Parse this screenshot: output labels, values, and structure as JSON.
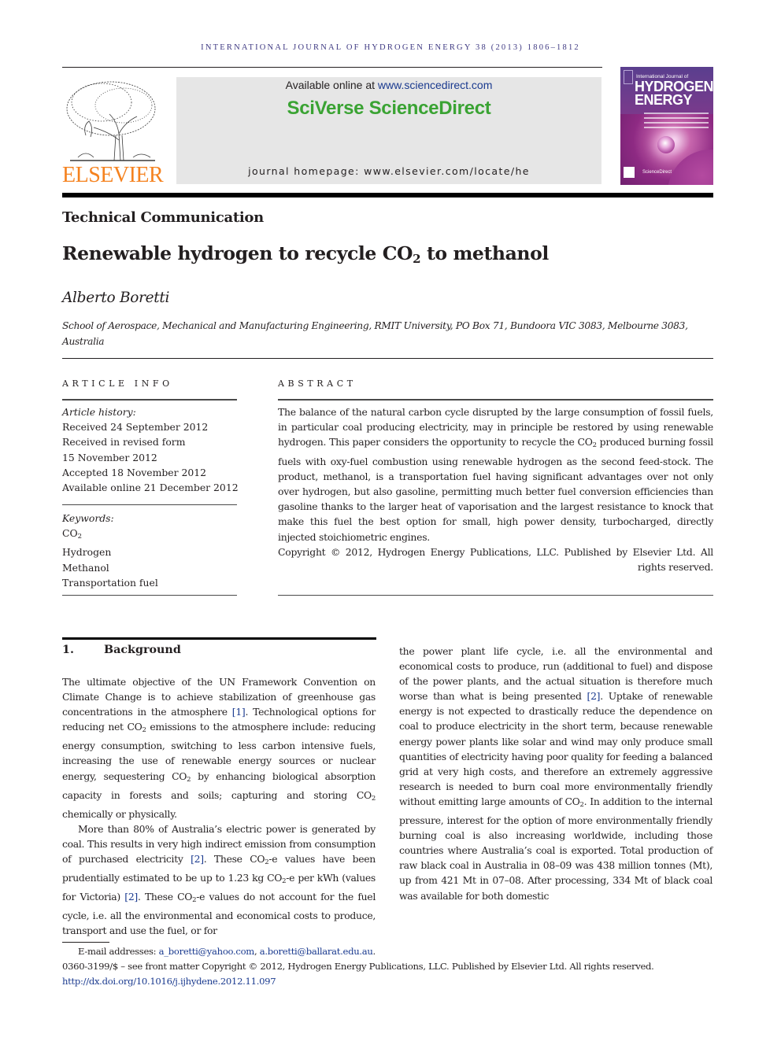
{
  "running_head": "International Journal of Hydrogen Energy 38 (2013) 1806–1812",
  "publisher": {
    "logo_word": "ELSEVIER",
    "logo_color": "#f5821f"
  },
  "banner": {
    "available_prefix": "Available online at ",
    "available_link": "www.sciencedirect.com",
    "brand": "SciVerse ScienceDirect",
    "brand_color": "#3aa333",
    "homepage": "journal homepage: www.elsevier.com/locate/he"
  },
  "cover": {
    "title_small": "International Journal of",
    "title_line1": "HYDROGEN",
    "title_line2": "ENERGY",
    "footer": "ScienceDirect"
  },
  "article": {
    "type": "Technical Communication",
    "title_pre": "Renewable hydrogen to recycle CO",
    "title_sub": "2",
    "title_post": " to methanol",
    "author": "Alberto Boretti",
    "affiliation": "School of Aerospace, Mechanical and Manufacturing Engineering, RMIT University, PO Box 71, Bundoora VIC 3083, Melbourne 3083, Australia"
  },
  "article_info": {
    "label": "ARTICLE INFO",
    "history_label": "Article history:",
    "history": [
      "Received 24 September 2012",
      "Received in revised form",
      "15 November 2012",
      "Accepted 18 November 2012",
      "Available online 21 December 2012"
    ],
    "keywords_label": "Keywords:",
    "keywords": [
      "CO",
      "Hydrogen",
      "Methanol",
      "Transportation fuel"
    ],
    "keyword_sub": "2"
  },
  "abstract": {
    "label": "ABSTRACT",
    "text_1": "The balance of the natural carbon cycle disrupted by the large consumption of fossil fuels, in particular coal producing electricity, may in principle be restored by using renewable hydrogen. This paper considers the opportunity to recycle the CO",
    "sub": "2",
    "text_2": " produced burning fossil fuels with oxy-fuel combustion using renewable hydrogen as the second feed-stock. The product, methanol, is a transportation fuel having significant advantages over not only over hydrogen, but also gasoline, permitting much better fuel conversion efficiencies than gasoline thanks to the larger heat of vaporisation and the largest resistance to knock that make this fuel the best option for small, high power density, turbocharged, directly injected stoichiometric engines.",
    "copyright": "Copyright © 2012, Hydrogen Energy Publications, LLC. Published by Elsevier Ltd. All rights reserved."
  },
  "section1": {
    "number": "1.",
    "title": "Background",
    "p1": [
      "The ultimate objective of the UN Framework Convention on Climate Change is to achieve stabilization of greenhouse gas concentrations in the atmosphere ",
      "[1]",
      ". Technological options for reducing net CO",
      " emissions to the atmosphere include: reducing energy consumption, switching to less carbon intensive fuels, increasing the use of renewable energy sources or nuclear energy, sequestering CO",
      " by enhancing biological absorption capacity in forests and soils; capturing and storing CO",
      " chemically or physically."
    ],
    "p2": [
      "More than 80% of Australia’s electric power is generated by coal. This results in very high indirect emission from consumption of purchased electricity ",
      "[2]",
      ". These CO",
      "-e values have been prudentially estimated to be up to 1.23 kg CO",
      "-e per kWh (values for Victoria) ",
      "[2]",
      ". These CO",
      "-e values do not account for the fuel cycle, i.e. all the environmental and economical costs to produce, transport and use the fuel, or for the power plant life cycle, i.e. all the environmental and economical costs to produce, run (additional to fuel) and dispose of the power plants, and the actual situation is therefore much worse than what is being presented ",
      "[2]",
      ". Uptake of renewable energy is not expected to drastically reduce the dependence on coal to produce electricity in the short term, because renewable energy power plants like solar and wind may only produce small quantities of electricity having poor quality for feeding a balanced grid at very high costs, and therefore an extremely aggressive research is needed to burn coal more environmentally friendly without emitting large amounts of CO",
      ". In addition to the internal pressure, interest for the option of more environmentally friendly burning coal is also increasing worldwide, including those countries where Australia’s coal is exported. Total production of raw black coal in Australia in 08–09 was 438 million tonnes (Mt), up from 421 Mt in 07–08. After processing, 334 Mt of black coal was available for both domestic"
    ],
    "sub": "2"
  },
  "footnotes": {
    "email_label": "E-mail addresses: ",
    "email_1": "a_boretti@yahoo.com",
    "email_sep": ", ",
    "email_2": "a.boretti@ballarat.edu.au",
    "email_end": ".",
    "issn_line": "0360-3199/$ – see front matter Copyright © 2012, Hydrogen Energy Publications, LLC. Published by Elsevier Ltd. All rights reserved.",
    "doi": "http://dx.doi.org/10.1016/j.ijhydene.2012.11.097"
  }
}
